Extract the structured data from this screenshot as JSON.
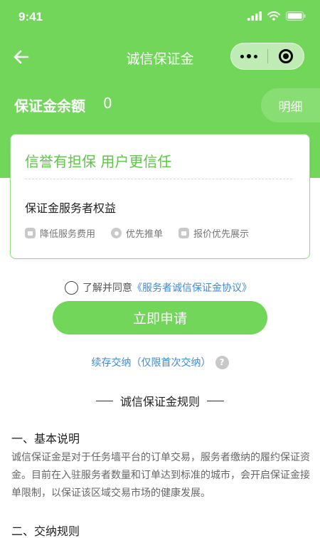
{
  "status_bar": {
    "time": "9:41"
  },
  "nav": {
    "title": "诚信保证金"
  },
  "balance": {
    "label": "保证金余额",
    "value": "0",
    "detail_label": "明细"
  },
  "card": {
    "slogan": "信誉有担保 用户更信任",
    "subtitle": "保证金服务者权益",
    "benefits": [
      {
        "icon": "ticket-icon",
        "label": "降低服务费用"
      },
      {
        "icon": "medal-icon",
        "label": "优先推单"
      },
      {
        "icon": "tag-icon",
        "label": "报价优先展示"
      }
    ]
  },
  "agreement": {
    "prefix": "了解并同意",
    "link": "《服务者诚信保证金协议》"
  },
  "apply_button": "立即申请",
  "renew": {
    "text": "续存交纳（仅限首次交纳）",
    "help": "?"
  },
  "rules": {
    "title": "诚信保证金规则",
    "sections": [
      {
        "title": "一、基本说明",
        "body": "诚信保证金是对于任务墙平台的订单交易，服务者缴纳的履约保证资金。目前在入驻服务者数量和订单达到标准的城市，会开启保证金接单限制，以保证该区域交易市场的健康发展。"
      },
      {
        "title": "二、交纳规则",
        "body": ""
      }
    ]
  },
  "colors": {
    "brand_green": "#72d65a",
    "link_blue": "#3f8ad6"
  }
}
